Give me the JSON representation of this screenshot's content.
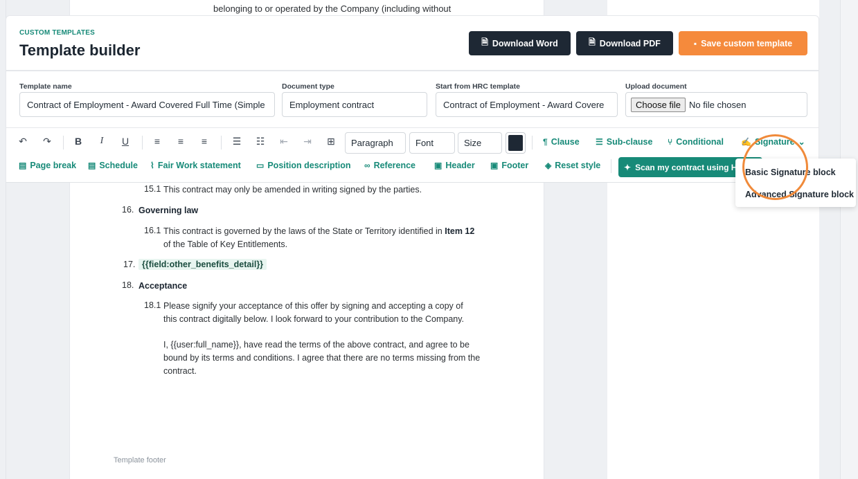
{
  "background_doc": {
    "line_cut": "(...) ... ... ... ... ... ...",
    "line": "belonging to or operated by the Company (including without"
  },
  "header": {
    "eyebrow": "CUSTOM TEMPLATES",
    "title": "Template builder",
    "download_word": "Download Word",
    "download_pdf": "Download PDF",
    "save": "Save custom template"
  },
  "form": {
    "template_name": {
      "label": "Template name",
      "value": "Contract of Employment - Award Covered Full Time (Simple"
    },
    "document_type": {
      "label": "Document type",
      "value": "Employment contract"
    },
    "hrc_template": {
      "label": "Start from HRC template",
      "value": "Contract of Employment - Award Covere"
    },
    "upload": {
      "label": "Upload document",
      "button": "Choose file",
      "status": "No file chosen"
    }
  },
  "toolbar": {
    "paragraph": "Paragraph",
    "font": "Font",
    "size": "Size",
    "text_color": "#1e2834",
    "actions": {
      "clause": "Clause",
      "sub_clause": "Sub-clause",
      "conditional": "Conditional",
      "signature": "Signature",
      "page_break": "Page break",
      "schedule": "Schedule",
      "fair_work": "Fair Work statement",
      "position_description": "Position description",
      "reference": "Reference",
      "header": "Header",
      "footer": "Footer",
      "reset_style": "Reset style",
      "scan": "Scan my contract using H"
    }
  },
  "document": {
    "c15_1": {
      "num": "15.1",
      "text": "This contract may only be amended in writing signed by the parties."
    },
    "c16": {
      "num": "16.",
      "title": "Governing law"
    },
    "c16_1": {
      "num": "16.1",
      "text_before": "This contract is governed by the laws of the State or Territory identified in ",
      "bold": "Item 12",
      "line2": "of the Table of Key Entitlements."
    },
    "c17": {
      "num": "17.",
      "field": "{{field:other_benefits_detail}}"
    },
    "c18": {
      "num": "18.",
      "title": "Acceptance"
    },
    "c18_1": {
      "num": "18.1",
      "p1_line1": "Please signify your acceptance of this offer by signing and accepting a copy of",
      "p1_line2": "this contract digitally below.  I look forward to your contribution to the Company.",
      "p2_line1": "I, {{user:full_name}}, have read the terms of the above contract, and agree to be",
      "p2_line2": "bound by its terms and conditions. I agree that there are no terms missing from the",
      "p2_line3": "contract."
    },
    "footer_label": "Template footer"
  },
  "signature_menu": {
    "items": [
      "Basic Signature block",
      "Advanced Signature block"
    ],
    "highlight_color": "#f08a3a"
  },
  "colors": {
    "accent": "#178a78",
    "dark": "#1e2834",
    "orange": "#f58a3c"
  }
}
